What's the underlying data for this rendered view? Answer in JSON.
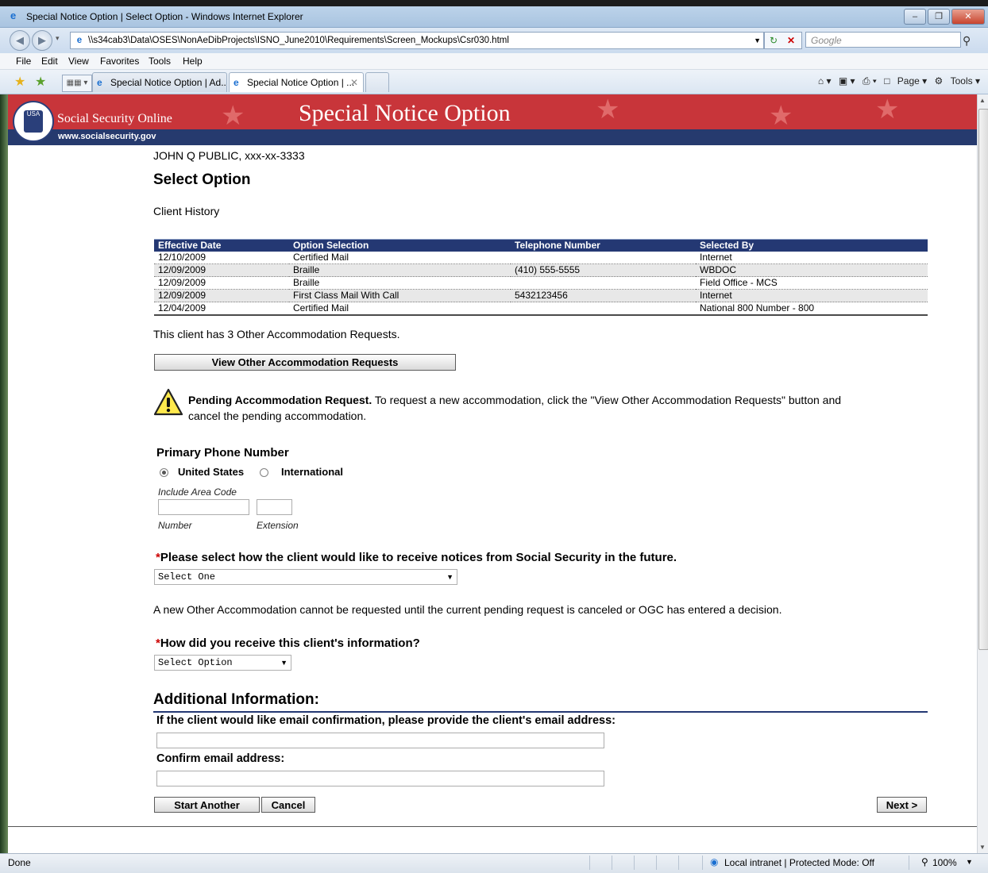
{
  "window": {
    "title": "Special Notice Option | Select Option - Windows Internet Explorer",
    "address": "\\\\s34cab3\\Data\\OSES\\NonAeDibProjects\\ISNO_June2010\\Requirements\\Screen_Mockups\\Csr030.html",
    "search_placeholder": "Google",
    "menu": [
      "File",
      "Edit",
      "View",
      "Favorites",
      "Tools",
      "Help"
    ],
    "tabs": [
      {
        "label": "Special Notice Option | Ad..."
      },
      {
        "label": "Special Notice Option | ..."
      }
    ],
    "cmd": {
      "page": "Page",
      "tools": "Tools"
    },
    "status": {
      "left": "Done",
      "zone": "Local intranet | Protected Mode: Off",
      "zoom": "100%"
    }
  },
  "banner": {
    "site": "Social Security Online",
    "url": "www.socialsecurity.gov",
    "title": "Special Notice Option",
    "seal_text": "USA"
  },
  "client_line": "JOHN Q PUBLIC, xxx-xx-3333",
  "page_title": "Select Option",
  "history_title": "Client History",
  "history": {
    "headers": [
      "Effective Date",
      "Option Selection",
      "Telephone Number",
      "Selected By"
    ],
    "rows": [
      [
        "12/10/2009",
        "Certified Mail",
        "",
        "Internet"
      ],
      [
        "12/09/2009",
        "Braille",
        "(410) 555-5555",
        "WBDOC"
      ],
      [
        "12/09/2009",
        "Braille",
        "",
        "Field Office - MCS"
      ],
      [
        "12/09/2009",
        "First Class Mail With Call",
        "5432123456",
        "Internet"
      ],
      [
        "12/04/2009",
        "Certified Mail",
        "",
        "National 800 Number - 800"
      ]
    ]
  },
  "other_requests_text": "This client has 3 Other Accommodation Requests.",
  "view_other_button": "View Other Accommodation Requests",
  "pending": {
    "bold": "Pending Accommodation Request.",
    "text": " To request a new accommodation, click the \"View Other Accommodation Requests\" button and",
    "text2": "cancel the pending accommodation."
  },
  "phone": {
    "heading": "Primary Phone Number",
    "option_us": "United States",
    "option_intl": "International",
    "hint": "Include Area Code",
    "number_label": "Number",
    "extension_label": "Extension",
    "number_value": "",
    "extension_value": ""
  },
  "notice_question": {
    "asterisk": "*",
    "text": "Please select how the client would like to receive notices from Social Security in the future.",
    "selected": "Select One"
  },
  "other_accommodation_note": "A new Other Accommodation cannot be requested until the current pending request is canceled or OGC has entered a decision.",
  "source_question": {
    "asterisk": "*",
    "text": "How did you receive this client's information?",
    "selected": "Select Option"
  },
  "additional": {
    "heading": "Additional Information:",
    "email_label": "If the client would like email confirmation, please provide the client's email address:",
    "confirm_label": "Confirm email address:",
    "email_value": "",
    "confirm_value": ""
  },
  "buttons": {
    "start_another": "Start Another",
    "cancel": "Cancel",
    "next": "Next >"
  },
  "colors": {
    "banner_red": "#c8353a",
    "banner_navy": "#263a6e",
    "table_header": "#243873",
    "required": "#cc0000"
  }
}
